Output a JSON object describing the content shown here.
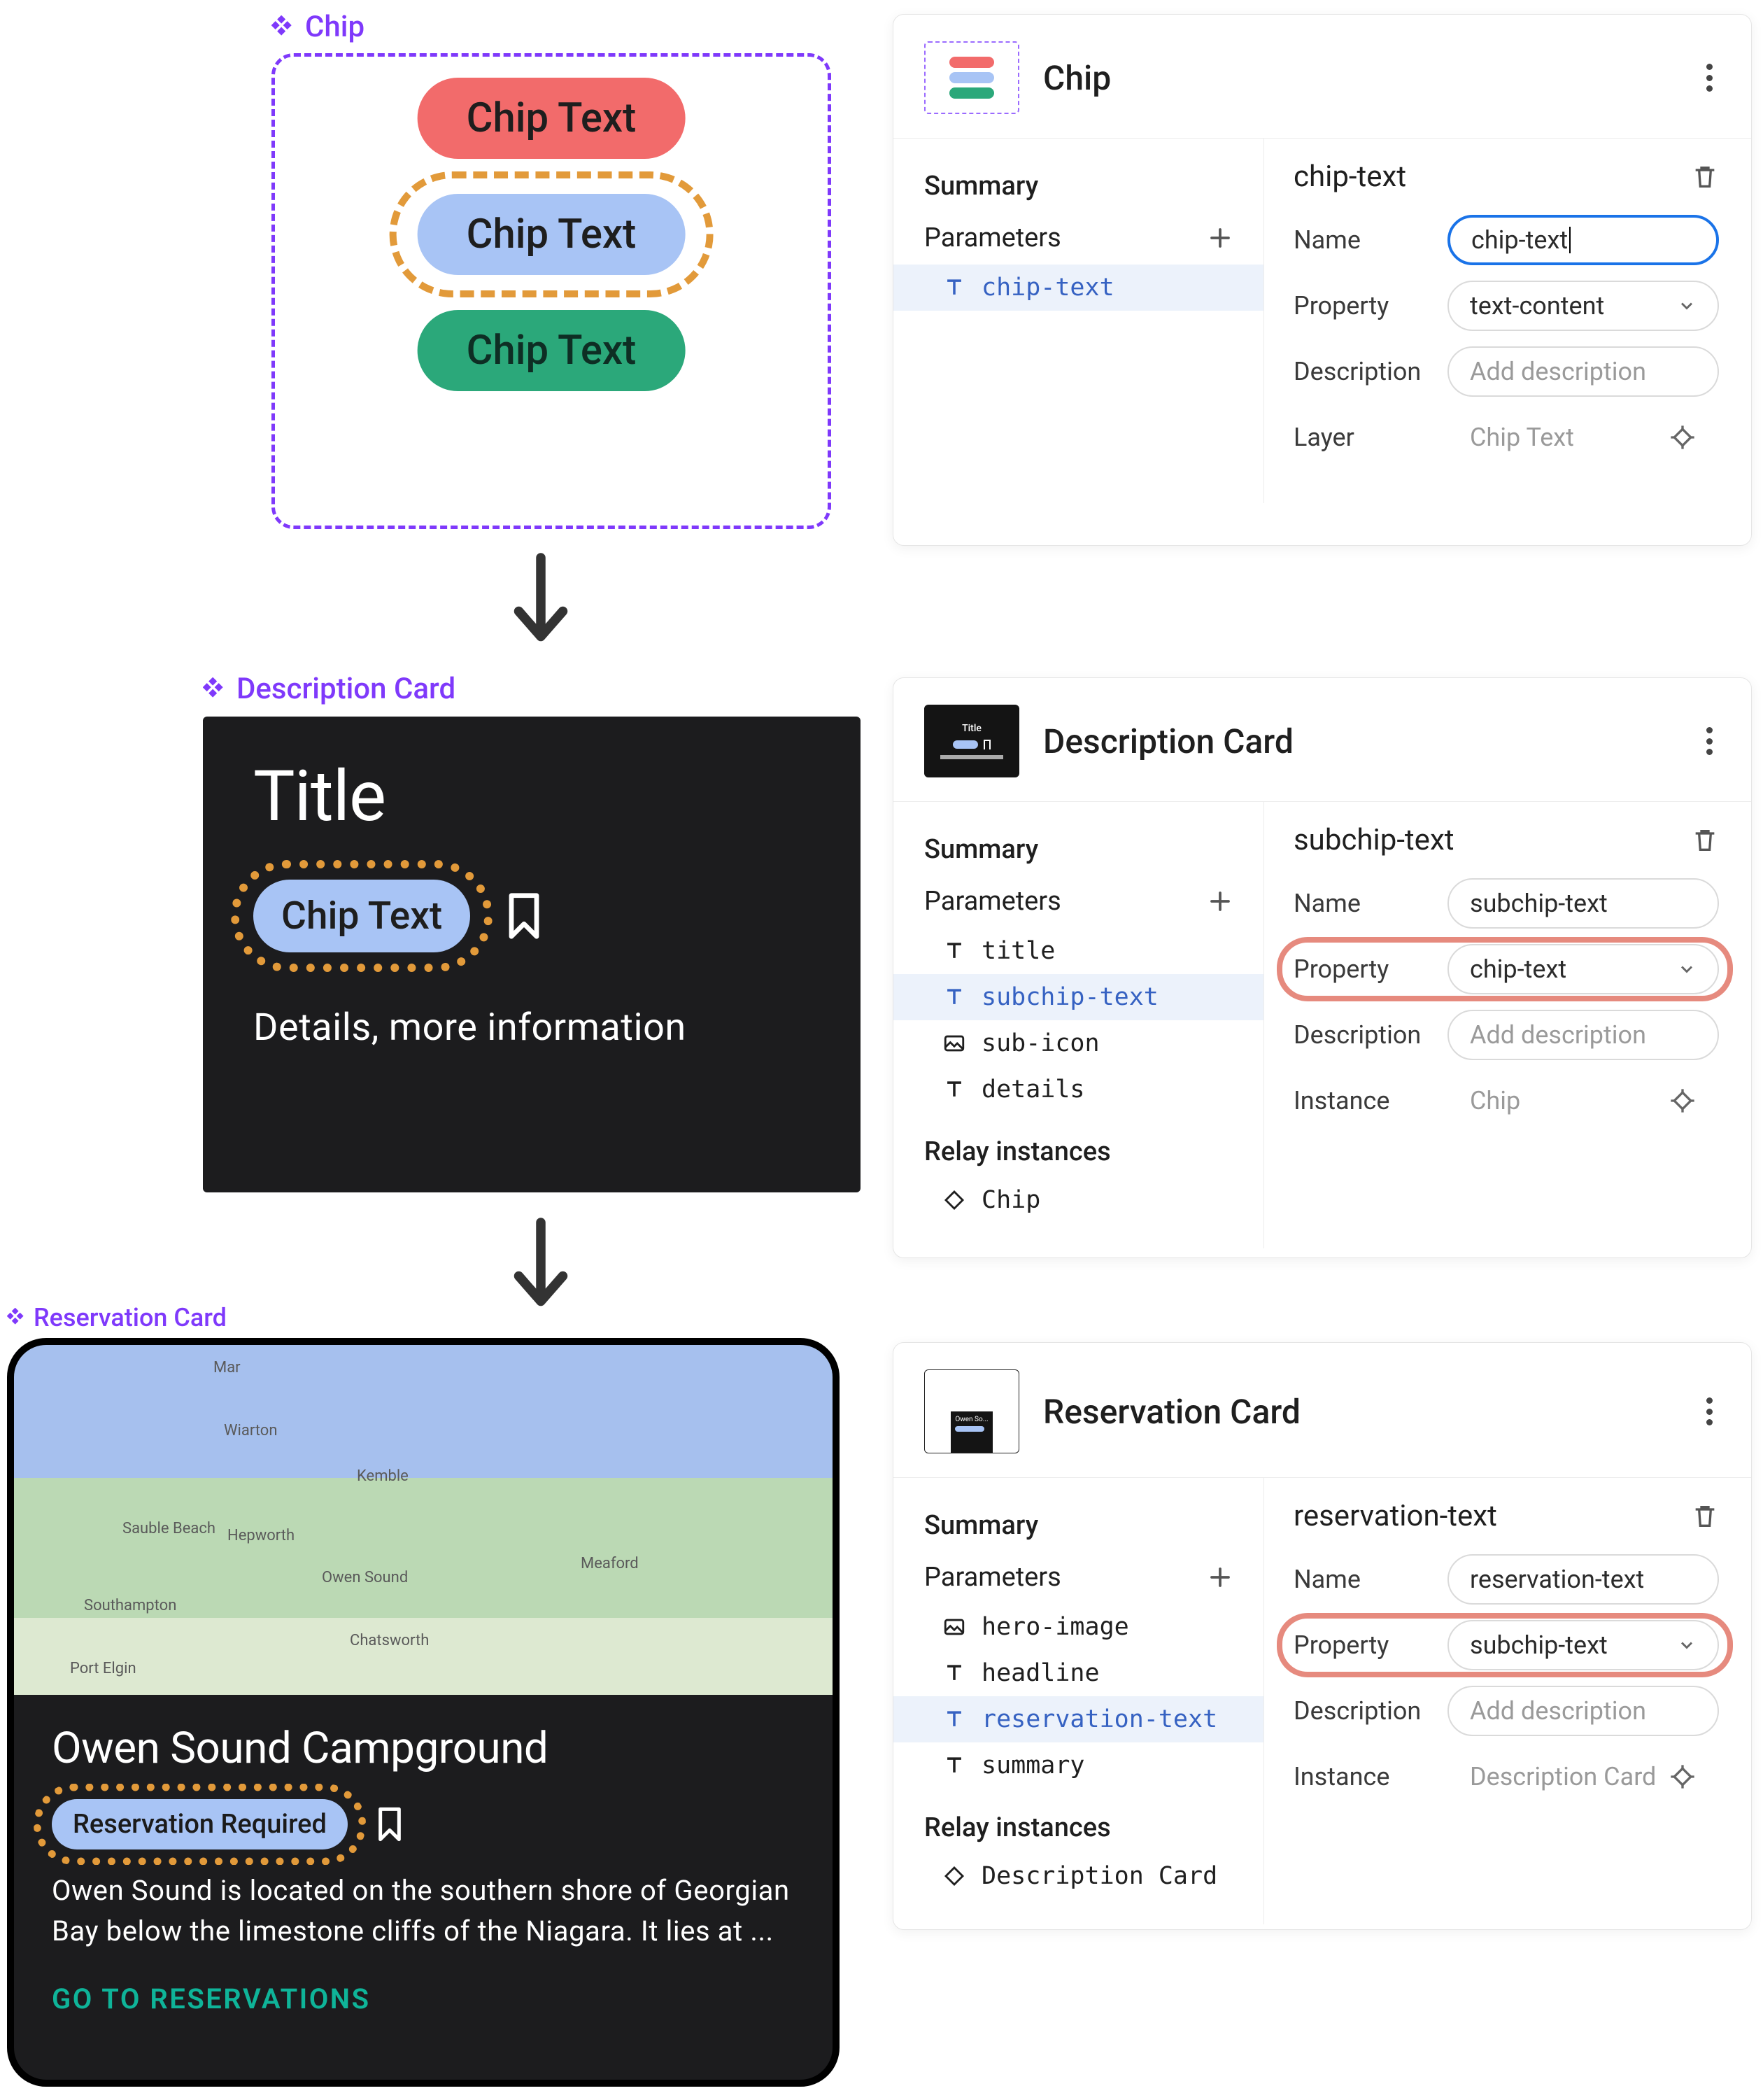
{
  "sections": {
    "chip": {
      "label": "Chip",
      "variants": [
        "Chip Text",
        "Chip Text",
        "Chip Text"
      ]
    },
    "descriptionCard": {
      "label": "Description Card",
      "title": "Title",
      "chipText": "Chip Text",
      "details": "Details, more information"
    },
    "reservationCard": {
      "label": "Reservation Card",
      "mapPlaces": [
        "Wiarton",
        "Kemble",
        "Sauble Beach",
        "Hepworth",
        "Owen Sound",
        "Meaford",
        "Southampton",
        "Chatsworth",
        "Port Elgin",
        "Mar"
      ],
      "headline": "Owen Sound Campground",
      "chipText": "Reservation Required",
      "summary": "Owen Sound is located on the southern shore of Georgian Bay below the limestone cliffs of the Niagara. It lies at ...",
      "cta": "GO TO RESERVATIONS"
    }
  },
  "panels": {
    "chip": {
      "title": "Chip",
      "left": {
        "summary": "Summary",
        "parameters": "Parameters",
        "params": [
          {
            "type": "text",
            "name": "chip-text",
            "selected": true
          }
        ]
      },
      "right": {
        "headerName": "chip-text",
        "rows": {
          "nameLabel": "Name",
          "nameValue": "chip-text",
          "propertyLabel": "Property",
          "propertyValue": "text-content",
          "descriptionLabel": "Description",
          "descriptionPlaceholder": "Add description",
          "layerLabel": "Layer",
          "layerValue": "Chip Text"
        }
      }
    },
    "descriptionCard": {
      "title": "Description Card",
      "left": {
        "summary": "Summary",
        "parameters": "Parameters",
        "params": [
          {
            "type": "text",
            "name": "title"
          },
          {
            "type": "text",
            "name": "subchip-text",
            "selected": true
          },
          {
            "type": "image",
            "name": "sub-icon"
          },
          {
            "type": "text",
            "name": "details"
          }
        ],
        "relayTitle": "Relay instances",
        "relays": [
          {
            "type": "instance",
            "name": "Chip"
          }
        ]
      },
      "right": {
        "headerName": "subchip-text",
        "rows": {
          "nameLabel": "Name",
          "nameValue": "subchip-text",
          "propertyLabel": "Property",
          "propertyValue": "chip-text",
          "descriptionLabel": "Description",
          "descriptionPlaceholder": "Add description",
          "instanceLabel": "Instance",
          "instanceValue": "Chip"
        }
      }
    },
    "reservationCard": {
      "title": "Reservation Card",
      "left": {
        "summary": "Summary",
        "parameters": "Parameters",
        "params": [
          {
            "type": "image",
            "name": "hero-image"
          },
          {
            "type": "text",
            "name": "headline"
          },
          {
            "type": "text",
            "name": "reservation-text",
            "selected": true
          },
          {
            "type": "text",
            "name": "summary"
          }
        ],
        "relayTitle": "Relay instances",
        "relays": [
          {
            "type": "instance",
            "name": "Description Card"
          }
        ]
      },
      "right": {
        "headerName": "reservation-text",
        "rows": {
          "nameLabel": "Name",
          "nameValue": "reservation-text",
          "propertyLabel": "Property",
          "propertyValue": "subchip-text",
          "descriptionLabel": "Description",
          "descriptionPlaceholder": "Add description",
          "instanceLabel": "Instance",
          "instanceValue": "Description Card"
        }
      }
    }
  }
}
